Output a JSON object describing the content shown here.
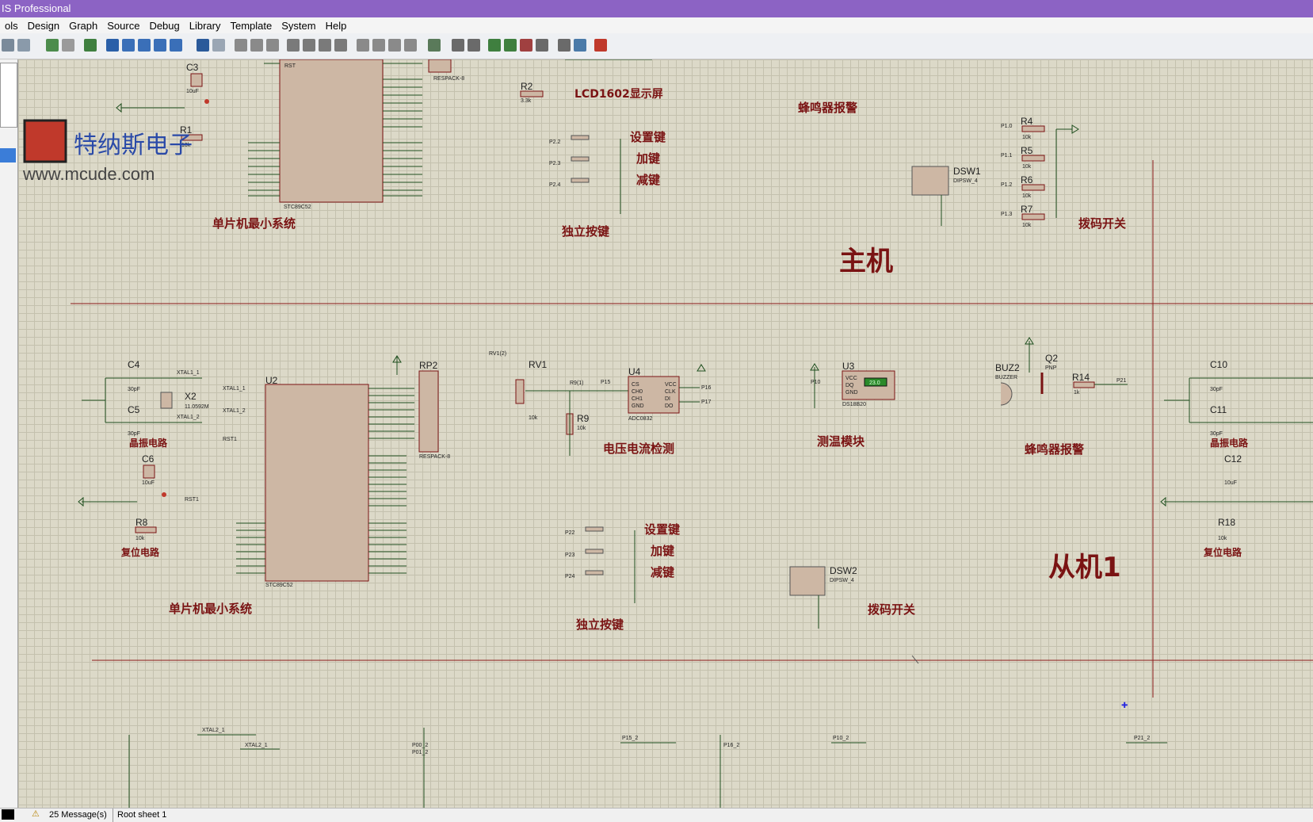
{
  "window": {
    "title": "IS Professional"
  },
  "menu": [
    "ols",
    "Design",
    "Graph",
    "Source",
    "Debug",
    "Library",
    "Template",
    "System",
    "Help"
  ],
  "watermark": {
    "brand": "特纳斯电子",
    "url": "www.mcude.com"
  },
  "master": {
    "section_title": "主机",
    "mcu_label": "STC89C52",
    "mcu_caption": "单片机最小系统",
    "lcd_caption": "LCD1602显示屏",
    "buzzer_caption": "蜂鸣器报警",
    "keys": [
      "设置键",
      "加键",
      "减键"
    ],
    "keys_caption": "独立按键",
    "dip_ref": "DSW1",
    "dip_model": "DIPSW_4",
    "dip_caption": "拨码开关",
    "resistors": [
      "R4",
      "R5",
      "R6",
      "R7"
    ],
    "res_nets": [
      "P1.0",
      "P1.1",
      "P1.2",
      "P1.3"
    ],
    "res_value": "10k",
    "c3": "C3",
    "c3_value": "10uF",
    "r1": "R1",
    "r1_value": "10k",
    "r2": "R2",
    "r2_value": "3.3k",
    "respack": "RESPACK-8",
    "rst": "RST",
    "key_nets": [
      "P2.2",
      "P2.3",
      "P2.4"
    ]
  },
  "slave": {
    "section_title": "从机1",
    "u2": "U2",
    "mcu_label": "STC89C52",
    "mcu_caption": "单片机最小系统",
    "crystal_caption": "晶振电路",
    "reset_caption": "复位电路",
    "c4": "C4",
    "c5": "C5",
    "c6": "C6",
    "x2": "X2",
    "x2_value": "11.0592M",
    "r8": "R8",
    "r8_value": "10k",
    "cap_value": "30pF",
    "c6_value": "10uF",
    "xtal1": "XTAL1_1",
    "xtal2": "XTAL1_2",
    "rst_net": "RST1",
    "rp2": "RP2",
    "rp2_model": "RESPACK-8",
    "rv1": "RV1",
    "rv1_value": "10k",
    "r9": "R9",
    "r9_value": "10k",
    "r9_net": "R9(1)",
    "rv_net": "RV1(2)",
    "u4": "U4",
    "u4_model": "ADC0832",
    "u4_pins_left": [
      "CS",
      "CH0",
      "CH1",
      "GND"
    ],
    "u4_pins_right": [
      "VCC",
      "CLK",
      "DI",
      "DO"
    ],
    "u4_nets": [
      "P15",
      "P16",
      "P17"
    ],
    "adc_caption": "电压电流检测",
    "u3": "U3",
    "u3_model": "DS18B20",
    "u3_pins": [
      "VCC",
      "DQ",
      "GND"
    ],
    "u3_temp": "23.0",
    "u3_net": "P10",
    "temp_caption": "测温模块",
    "buz": "BUZ2",
    "buz_model": "BUZZER",
    "q2": "Q2",
    "q2_model": "PNP",
    "r14": "R14",
    "r14_value": "1k",
    "buz_net": "P21",
    "buzzer_caption": "蜂鸣器报警",
    "keys": [
      "设置键",
      "加键",
      "减键"
    ],
    "key_nets": [
      "P22",
      "P23",
      "P24"
    ],
    "keys_caption": "独立按键",
    "dip_ref": "DSW2",
    "dip_model": "DIPSW_4",
    "dip_caption": "拨码开关"
  },
  "edge_right": {
    "c10": "C10",
    "c11": "C11",
    "c12": "C12",
    "r18": "R18",
    "crystal": "晶振电路",
    "reset": "复位电路",
    "c12_value": "10uF",
    "r18_value": "10k",
    "cap_value": "30pF"
  },
  "bottom_nets": [
    "XTAL2_1",
    "XTAL2_1",
    "P00_2",
    "P01_2",
    "P15_2",
    "P16_2",
    "P10_2",
    "P21_2"
  ],
  "status": {
    "messages": "25 Message(s)",
    "sheet": "Root sheet 1"
  },
  "colors": {
    "title_bar": "#8c63c4",
    "canvas": "#dcd9c8",
    "caption": "#7a1313",
    "wire": "#1f4f1f",
    "component_fill": "#cdb7a4"
  }
}
